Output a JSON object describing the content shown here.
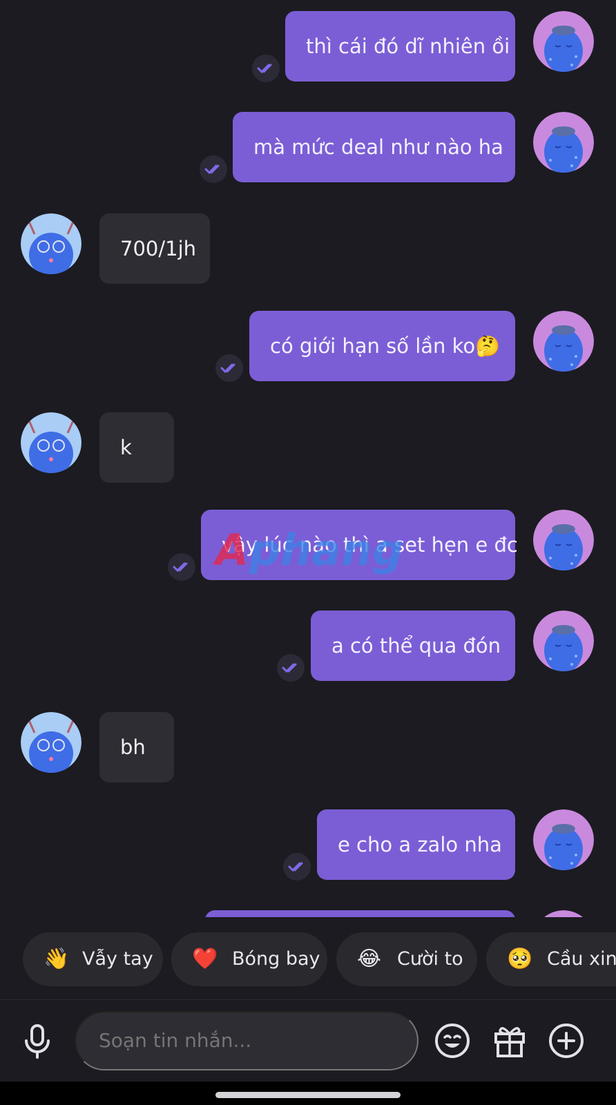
{
  "messages": [
    {
      "side": "out",
      "text": "thì cái đó dĩ nhiên ồi"
    },
    {
      "side": "out",
      "text": "mà mức deal như nào ha"
    },
    {
      "side": "in",
      "text": "700/1jh"
    },
    {
      "side": "out",
      "text": "có giới hạn số lần ko🤔"
    },
    {
      "side": "in",
      "text": "k"
    },
    {
      "side": "out",
      "text": "vậy lúc nào thì a set hẹn e đc"
    },
    {
      "side": "out",
      "text": "a có thể qua đón"
    },
    {
      "side": "in",
      "text": "bh"
    },
    {
      "side": "out",
      "text": "e cho a zalo nha"
    }
  ],
  "watermark": {
    "a": "A",
    "rest": "phang"
  },
  "quick_reactions": [
    {
      "emoji": "👋",
      "label": "Vẫy tay"
    },
    {
      "emoji": "❤️",
      "label": "Bóng bay"
    },
    {
      "emoji": "😂",
      "label": "Cười to"
    },
    {
      "emoji": "🥺",
      "label": "Cầu xin"
    }
  ],
  "composer": {
    "placeholder": "Soạn tin nhắn..."
  },
  "icons": {
    "mic": "mic-icon",
    "emoji": "emoji-icon",
    "gift": "gift-icon",
    "add": "plus-circle-icon",
    "read_receipt": "double-check-icon"
  },
  "colors": {
    "background": "#1c1b21",
    "outgoing_bubble": "#7b5ed5",
    "incoming_bubble": "#2e2d33",
    "avatar_out_bg": "#c98ade",
    "avatar_in_bg": "#a9cdf5",
    "avatar_face": "#3f6de6"
  }
}
